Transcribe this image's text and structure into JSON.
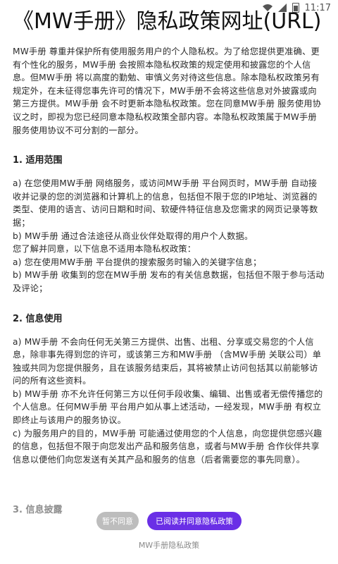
{
  "status_bar": {
    "time": "11:17",
    "icons": [
      "wifi-icon",
      "cellular-signal-icon",
      "battery-icon"
    ]
  },
  "page": {
    "title": "《MW手册》隐私政策网址(URL)",
    "intro": "MW手册 尊重并保护所有使用服务用户的个人隐私权。为了给您提供更准确、更有个性化的服务，MW手册 会按照本隐私权政策的规定使用和披露您的个人信息。但MW手册 将以高度的勤勉、审慎义务对待这些信息。除本隐私权政策另有规定外，在未征得您事先许可的情况下，MW手册不会将这些信息对外披露或向第三方提供。MW手册 会不时更新本隐私权政策。您在同意MW手册 服务使用协议之时，即视为您已经同意本隐私权政策全部内容。本隐私权政策属于MW手册 服务使用协议不可分割的一部分。",
    "section1_title": "1. 适用范围",
    "section1_a": "a) 在您使用MW手册 网络服务，或访问MW手册 平台网页时，MW手册 自动接收并记录的您的浏览器和计算机上的信息，包括但不限于您的IP地址、浏览器的类型、使用的语言、访问日期和时间、软硬件特征信息及您需求的网页记录等数据；",
    "section1_b": "b) MW手册 通过合法途径从商业伙伴处取得的用户个人数据。",
    "section1_note": "您了解并同意，以下信息不适用本隐私权政策：",
    "section1_na": "a) 您在使用MW手册 平台提供的搜索服务时输入的关键字信息；",
    "section1_nb": "b) MW手册 收集到的您在MW手册 发布的有关信息数据，包括但不限于参与活动及评论；",
    "section2_title": "2. 信息使用",
    "section2_a": "a) MW手册 不会向任何无关第三方提供、出售、出租、分享或交易您的个人信息，除非事先得到您的许可，或该第三方和MW手册 （含MW手册 关联公司）单独或共同为您提供服务，且在该服务结束后，其将被禁止访问包括其以前能够访问的所有这些资料。",
    "section2_b": "b) MW手册 亦不允许任何第三方以任何手段收集、编辑、出售或者无偿传播您的个人信息。任何MW手册 平台用户如从事上述活动，一经发现，MW手册 有权立即终止与该用户的服务协议。",
    "section2_c": "c) 为服务用户的目的，MW手册 可能通过使用您的个人信息，向您提供您感兴趣的信息，包括但不限于向您发出产品和服务信息，或者与MW手册 合作伙伴共享信息以便他们向您发送有关其产品和服务的信息（后者需要您的事先同意）。",
    "section3_cut": "3. 信息披露"
  },
  "actions": {
    "disagree_label": "暂不同意",
    "agree_label": "已阅读并同意隐私政策"
  },
  "footer_label": "MW手册隐私政策",
  "colors": {
    "agree_button": "#6a2fe6",
    "disagree_button": "#bdbdbd"
  }
}
